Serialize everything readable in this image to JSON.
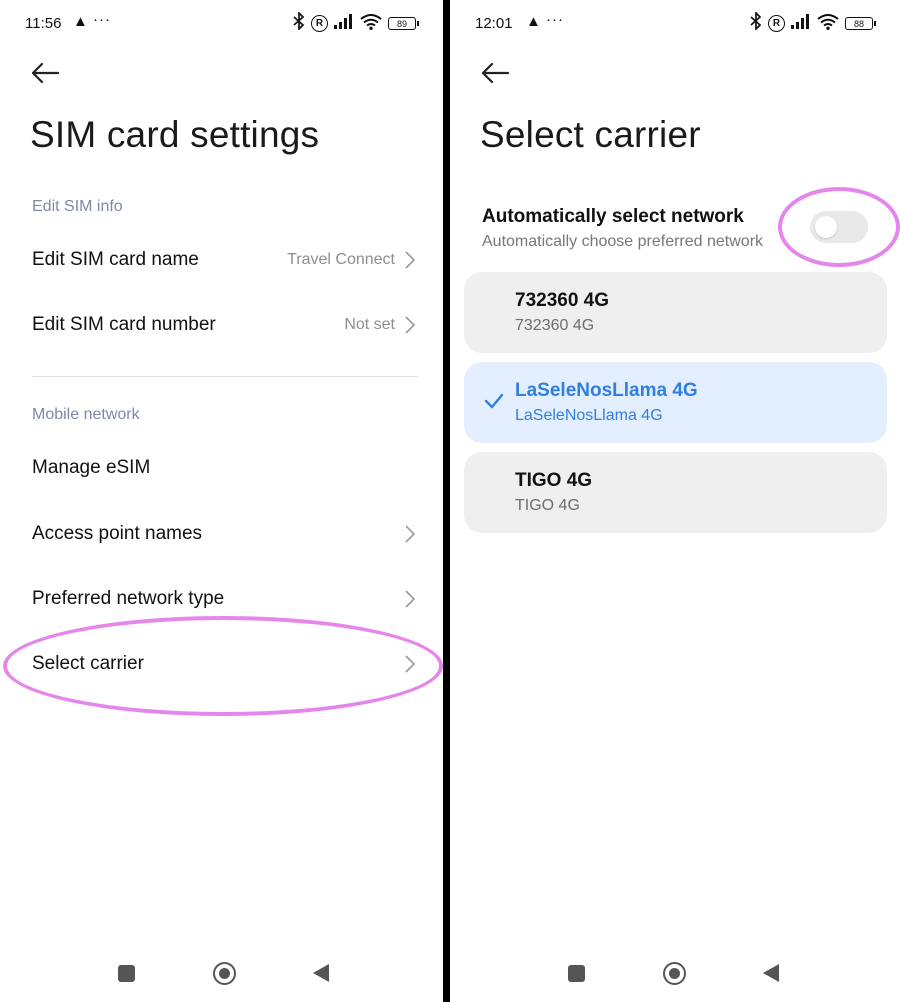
{
  "left": {
    "status": {
      "time": "11:56",
      "alert_icon": "warning-icon",
      "more": "···",
      "battery": "89"
    },
    "title": "SIM card settings",
    "sections": {
      "edit_sim_info": "Edit SIM info",
      "mobile_network": "Mobile network"
    },
    "rows": {
      "edit_name": {
        "label": "Edit SIM card name",
        "value": "Travel Connect"
      },
      "edit_number": {
        "label": "Edit SIM card number",
        "value": "Not set"
      },
      "manage_esim": {
        "label": "Manage eSIM"
      },
      "apn": {
        "label": "Access point names"
      },
      "pref_network": {
        "label": "Preferred network type"
      },
      "select_carrier": {
        "label": "Select carrier"
      }
    }
  },
  "right": {
    "status": {
      "time": "12:01",
      "alert_icon": "warning-icon",
      "more": "···",
      "battery": "88"
    },
    "title": "Select carrier",
    "auto": {
      "title": "Automatically select network",
      "subtitle": "Automatically choose preferred network",
      "enabled": false
    },
    "carriers": [
      {
        "name": "732360 4G",
        "sub": "732360 4G",
        "selected": false
      },
      {
        "name": "LaSeleNosLlama 4G",
        "sub": "LaSeleNosLlama 4G",
        "selected": true
      },
      {
        "name": "TIGO 4G",
        "sub": "TIGO 4G",
        "selected": false
      }
    ]
  },
  "colors": {
    "accent_blue": "#2f7fe0",
    "selected_bg": "#e3efff",
    "highlight": "#e486ec",
    "section_label": "#7d8aa6"
  }
}
